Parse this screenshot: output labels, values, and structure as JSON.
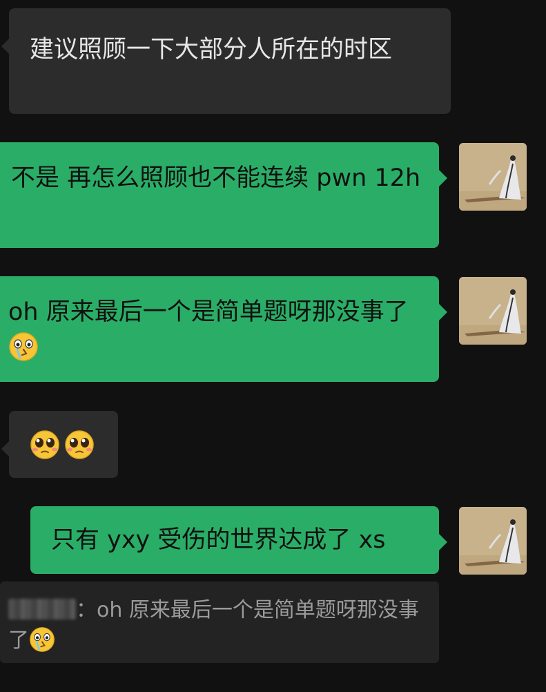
{
  "messages": [
    {
      "side": "in",
      "text": "建议照顾一下大部分人所在的时区"
    },
    {
      "side": "out",
      "text": "不是 再怎么照顾也不能连续 pwn 12h"
    },
    {
      "side": "out",
      "text": "oh 原来最后一个是简单题呀那没事了",
      "emoji": "crying-face"
    },
    {
      "side": "in",
      "emoji": [
        "pleading-face",
        "pleading-face"
      ]
    },
    {
      "side": "out",
      "text": "只有 yxy 受伤的世界达成了 xs"
    }
  ],
  "quote": {
    "separator": "：",
    "text": "oh 原来最后一个是简单题呀那没事了",
    "emoji": "crying-face"
  },
  "colors": {
    "background": "#111111",
    "incoming_bubble": "#2c2c2c",
    "outgoing_bubble": "#2aae67",
    "quote_bg": "#232323"
  }
}
